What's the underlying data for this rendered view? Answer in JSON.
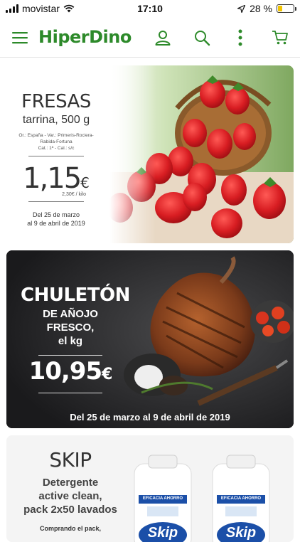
{
  "status_bar": {
    "carrier": "movistar",
    "time": "17:10",
    "battery": "28 %",
    "battery_level": 0.28
  },
  "header": {
    "logo": "HiperDino",
    "icons": [
      "menu-icon",
      "user-icon",
      "search-icon",
      "more-icon",
      "cart-icon"
    ],
    "accent_color": "#2d8a2a"
  },
  "promos": [
    {
      "title": "FRESAS",
      "subtitle": "tarrina, 500 g",
      "details": [
        "Or.: España - Var.: Primeris-Rociera-",
        "Rabida-Fortuna",
        "Cat.: 1ª - Cal.: s/c"
      ],
      "price": "1,15",
      "currency": "€",
      "per_unit": "2,30€ / kilo",
      "dates_line1": "Del 25 de marzo",
      "dates_line2": "al 9 de abril de 2019"
    },
    {
      "title": "CHULETÓN",
      "subtitle_line1": "DE AÑOJO FRESCO,",
      "subtitle_line2": "el kg",
      "price": "10,95",
      "currency": "€",
      "dates": "Del 25 de marzo al 9 de abril de 2019"
    },
    {
      "title": "SKIP",
      "subtitle_line1": "Detergente",
      "subtitle_line2": "active clean,",
      "subtitle_line3": "pack 2x50 lavados",
      "note": "Comprando el pack,",
      "product_badge": "EFICACIA AHORRO",
      "product_brand": "Skip"
    }
  ]
}
